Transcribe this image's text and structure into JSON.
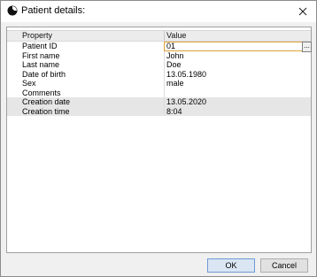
{
  "window": {
    "title": "Patient details:"
  },
  "grid": {
    "headers": {
      "property": "Property",
      "value": "Value"
    },
    "rows": [
      {
        "property": "Patient ID",
        "value": "01"
      },
      {
        "property": "First name",
        "value": "John"
      },
      {
        "property": "Last name",
        "value": "Doe"
      },
      {
        "property": "Date of birth",
        "value": "13.05.1980"
      },
      {
        "property": "Sex",
        "value": "male"
      },
      {
        "property": "Comments",
        "value": ""
      },
      {
        "property": "Creation date",
        "value": "13.05.2020"
      },
      {
        "property": "Creation time",
        "value": "8:04"
      }
    ],
    "ellipsis": "..."
  },
  "buttons": {
    "ok": "OK",
    "cancel": "Cancel"
  },
  "icons": {
    "app": "app-icon",
    "close": "close-icon"
  },
  "colors": {
    "selection_border": "#e0a33a",
    "readonly_row": "#e6e6e6"
  }
}
